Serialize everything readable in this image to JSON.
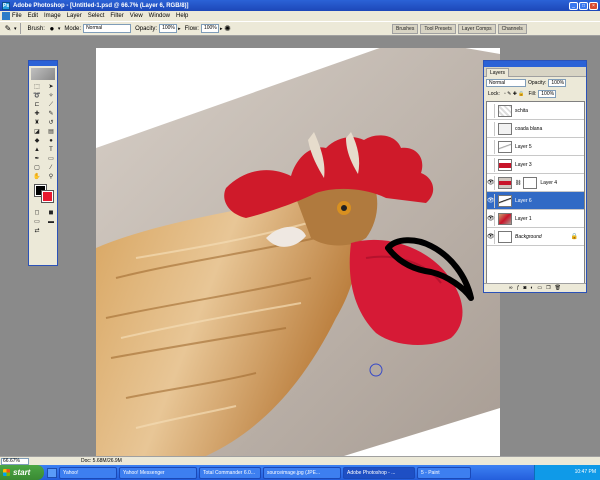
{
  "window": {
    "title": "Adobe Photoshop - [Untitled-1.psd @ 66.7% (Layer 6, RGB/8)]",
    "buttons": [
      "_",
      "□",
      "×"
    ]
  },
  "menu": [
    "File",
    "Edit",
    "Image",
    "Layer",
    "Select",
    "Filter",
    "View",
    "Window",
    "Help"
  ],
  "options": {
    "brush_label": "Brush:",
    "mode_label": "Mode:",
    "mode_value": "Normal",
    "opacity_label": "Opacity:",
    "opacity_value": "100%",
    "flow_label": "Flow:",
    "flow_value": "100%"
  },
  "palette_well": [
    "Brushes",
    "Tool Presets",
    "Layer Comps",
    "Channels"
  ],
  "layers_panel": {
    "tab": "Layers",
    "blend_mode": "Normal",
    "opacity_label": "Opacity:",
    "opacity_value": "100%",
    "lock_label": "Lock:",
    "fill_label": "Fill:",
    "fill_value": "100%",
    "layers": [
      {
        "name": "schita",
        "visible": false,
        "selected": false
      },
      {
        "name": "coada blana",
        "visible": false,
        "selected": false
      },
      {
        "name": "Layer 5",
        "visible": false,
        "selected": false
      },
      {
        "name": "Layer 3",
        "visible": false,
        "selected": false
      },
      {
        "name": "Layer 4",
        "visible": true,
        "selected": false
      },
      {
        "name": "Layer 6",
        "visible": true,
        "selected": true
      },
      {
        "name": "Layer 1",
        "visible": true,
        "selected": false
      },
      {
        "name": "Background",
        "visible": true,
        "selected": false
      }
    ]
  },
  "status": {
    "zoom": "66.67%",
    "doc": "Doc: 5.68M/26.9M"
  },
  "taskbar": {
    "start": "start",
    "tasks": [
      "Yahoo!",
      "Yahoo! Messenger",
      "Total Commander 6.0...",
      "sourceimage.jpg (JPE...",
      "Adobe Photoshop - ...",
      "5 - Paint"
    ],
    "clock": "10:47 PM"
  }
}
